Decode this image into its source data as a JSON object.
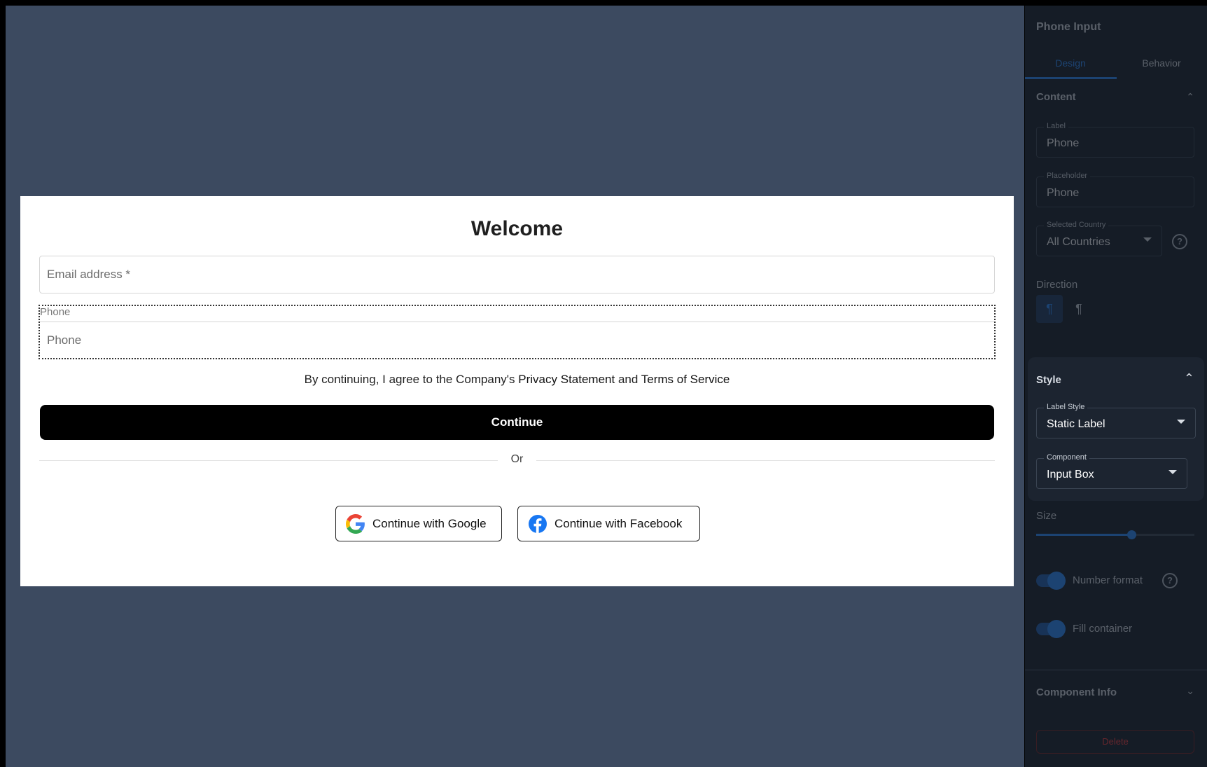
{
  "form": {
    "title": "Welcome",
    "email_placeholder": "Email address *",
    "phone_label": "Phone",
    "phone_placeholder": "Phone",
    "terms_prefix": "By continuing, I agree to the Company's",
    "privacy_link": "Privacy Statement",
    "terms_and": "and",
    "terms_link": "Terms of Service",
    "continue_label": "Continue",
    "or_label": "Or",
    "google_label": "Continue with Google",
    "facebook_label": "Continue with Facebook"
  },
  "panel": {
    "title": "Phone Input",
    "tabs": [
      {
        "label": "Design",
        "active": true
      },
      {
        "label": "Behavior",
        "active": false
      }
    ],
    "content_section": "Content",
    "label_field": {
      "label": "Label",
      "value": "Phone"
    },
    "placeholder_field": {
      "label": "Placeholder",
      "value": "Phone"
    },
    "country_field": {
      "label": "Selected Country",
      "value": "All Countries"
    },
    "direction_section": "Direction",
    "style_section": "Style",
    "label_style_field": {
      "label": "Label Style",
      "value": "Static Label"
    },
    "component_field": {
      "label": "Component",
      "value": "Input Box"
    },
    "size_section": "Size",
    "size_level": 0.6,
    "number_format_label": "Number format",
    "number_format_on": true,
    "fill_container_label": "Fill container",
    "fill_container_on": true,
    "component_info_section": "Component Info",
    "delete_label": "Delete"
  },
  "colors": {
    "canvas_bg": "#3c4a60",
    "panel_bg": "#151c26",
    "accent": "#2a8cff",
    "danger": "#ff3b3b"
  },
  "icons": [
    "google-icon",
    "facebook-icon",
    "chevron-up-icon",
    "chevron-down-icon",
    "help-icon",
    "ltr-icon",
    "rtl-icon"
  ]
}
